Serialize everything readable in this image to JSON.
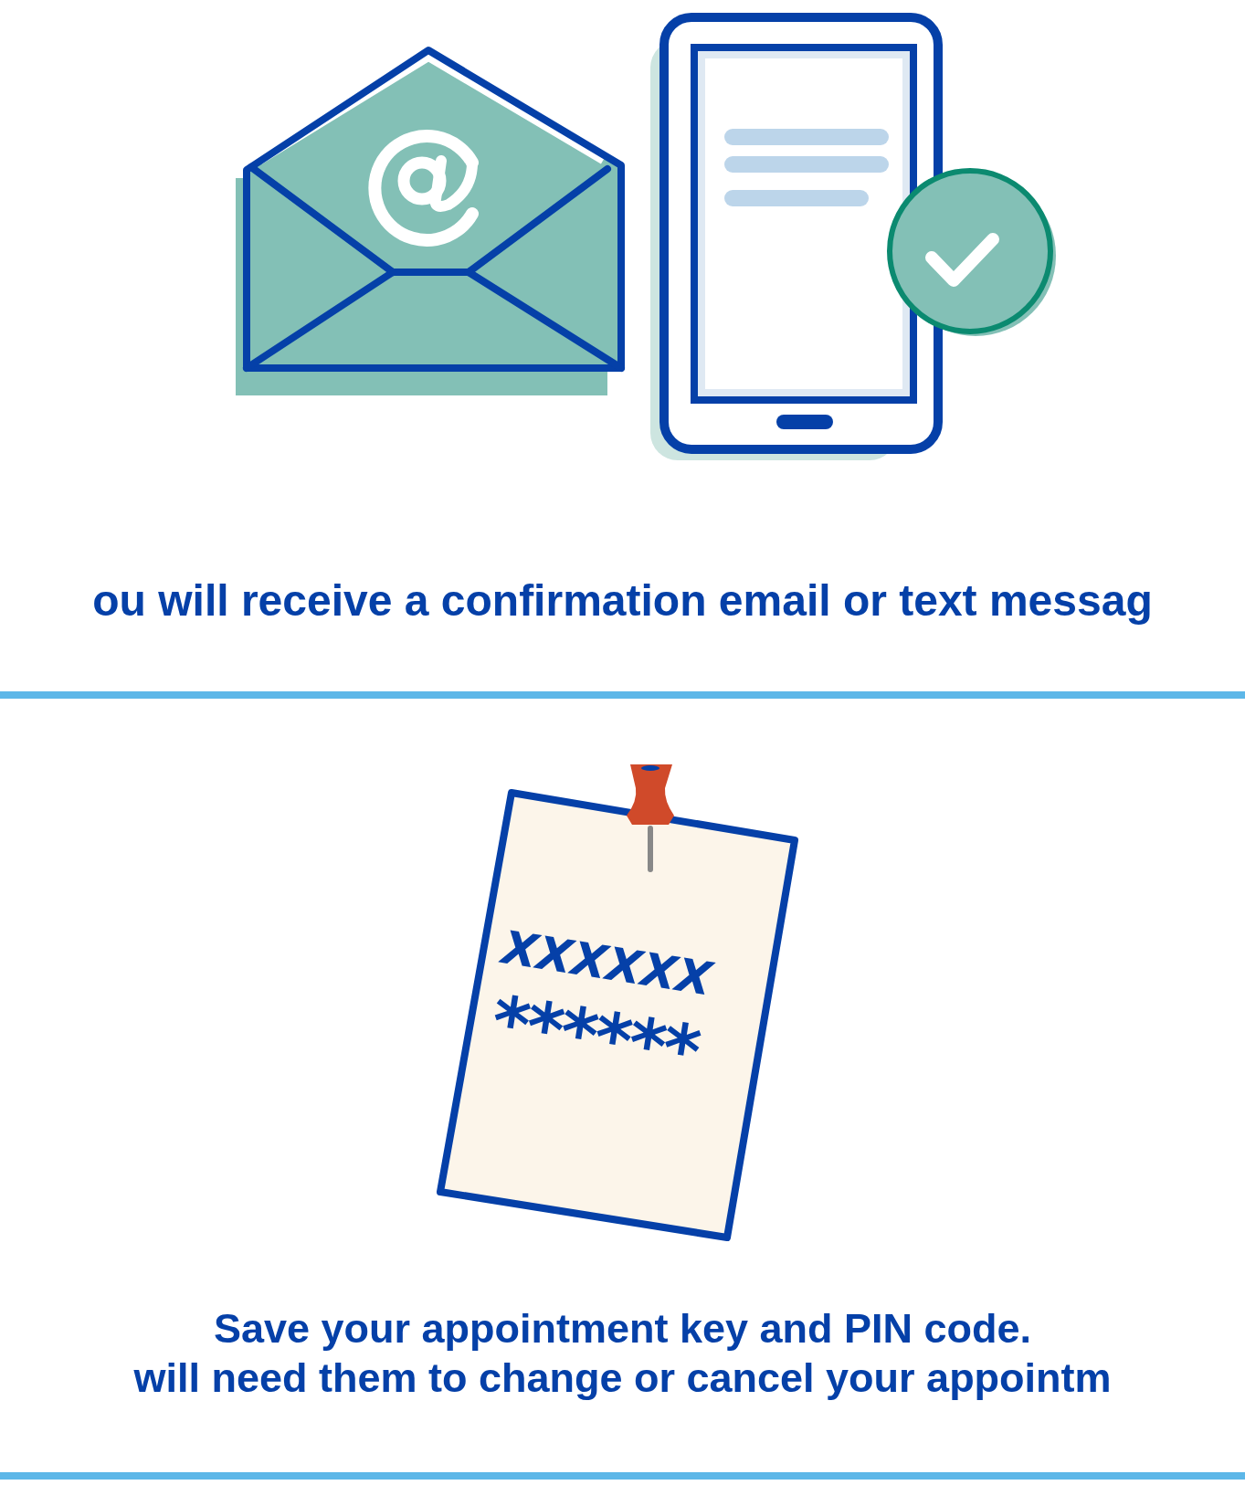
{
  "confirmation": {
    "message": "ou will receive a confirmation email or text messag"
  },
  "reminder": {
    "note_lines": [
      "XXXXXX",
      "******"
    ],
    "caption_lines": [
      "Save your appointment key and PIN code.",
      "will need them to change or cancel your appointm"
    ]
  }
}
